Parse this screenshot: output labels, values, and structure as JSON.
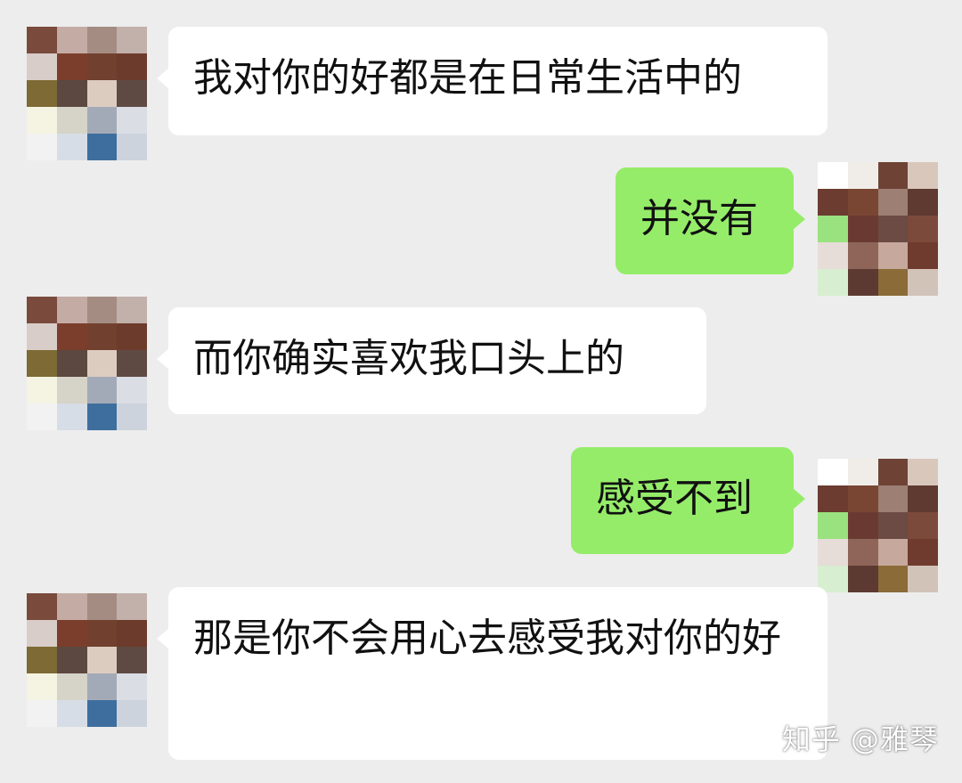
{
  "messages": [
    {
      "side": "left",
      "text": "我对你的好都是在日常生活中的"
    },
    {
      "side": "right",
      "text": "并没有"
    },
    {
      "side": "left",
      "text": "而你确实喜欢我口头上的"
    },
    {
      "side": "right",
      "text": "感受不到"
    },
    {
      "side": "left",
      "text": "那是你不会用心去感受我对你的好"
    }
  ],
  "watermark": "知乎 @雅琴",
  "colors": {
    "background": "#ededed",
    "incoming_bubble": "#ffffff",
    "outgoing_bubble": "#95ec69",
    "text": "#111111"
  },
  "avatars": {
    "contact": {
      "icon": "pixelated-avatar-icon",
      "palette": [
        "#7a4a3c",
        "#c4aca4",
        "#a58c82",
        "#c2b0ab",
        "#d8cdc9",
        "#7b3e2c",
        "#71402f",
        "#6d3b2b",
        "#7d6a34",
        "#5c4840",
        "#dcccbf",
        "#5f4a43",
        "#f5f3e2",
        "#d6d3c8",
        "#a3aab7",
        "#dadde4",
        "#f2f2f2",
        "#d7dde6",
        "#3e6e9e",
        "#ccd3dc"
      ]
    },
    "self": {
      "icon": "pixelated-avatar-icon",
      "palette": [
        "#ffffff",
        "#f0ede9",
        "#6e4336",
        "#d9c7bc",
        "#6b3c2f",
        "#7a4634",
        "#9d7f74",
        "#5f3a30",
        "#9ae27f",
        "#6a3a32",
        "#6b4b44",
        "#7c4a3b",
        "#e6dcd8",
        "#8f655a",
        "#c6a89c",
        "#6f3b2e",
        "#d8eed0",
        "#5d3a31",
        "#8b6b37",
        "#d2c3b9"
      ]
    }
  }
}
